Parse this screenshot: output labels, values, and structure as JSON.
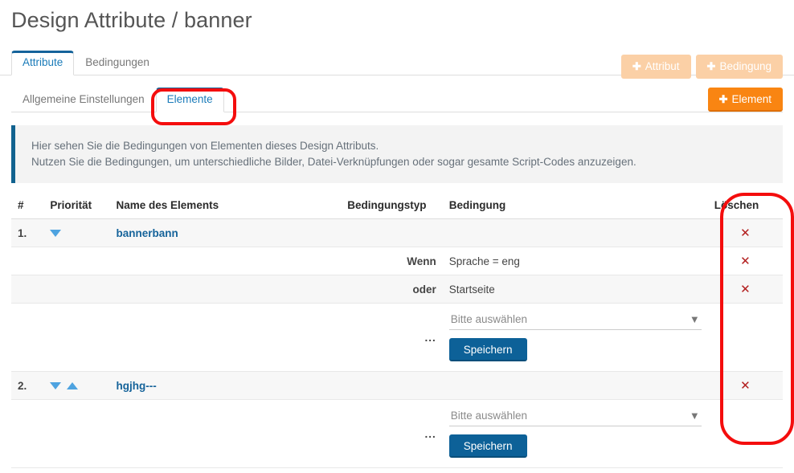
{
  "page": {
    "title": "Design Attribute / banner"
  },
  "main_tabs": [
    {
      "label": "Attribute",
      "active": true
    },
    {
      "label": "Bedingungen",
      "active": false
    }
  ],
  "top_actions": [
    {
      "label": "Attribut",
      "icon": "plus-icon",
      "state": "disabled"
    },
    {
      "label": "Bedingung",
      "icon": "plus-icon",
      "state": "disabled"
    }
  ],
  "sub_tabs": [
    {
      "label": "Allgemeine Einstellungen",
      "active": false
    },
    {
      "label": "Elemente",
      "active": true
    }
  ],
  "element_button": {
    "label": "Element",
    "icon": "plus-icon"
  },
  "info": {
    "line1": "Hier sehen Sie die Bedingungen von Elementen dieses Design Attributs.",
    "line2": "Nutzen Sie die Bedingungen, um unterschiedliche Bilder, Datei-Verknüpfungen oder sogar gesamte Script-Codes anzuzeigen."
  },
  "table": {
    "headers": {
      "num": "#",
      "priority": "Priorität",
      "name": "Name des Elements",
      "condition_type": "Bedingungstyp",
      "condition": "Bedingung",
      "delete": "Löschen"
    },
    "rows": [
      {
        "kind": "element",
        "index": "1.",
        "name": "bannerbann",
        "arrows": [
          "down"
        ],
        "condition_type": "",
        "condition": "",
        "delete": "✕"
      },
      {
        "kind": "condition",
        "index": "",
        "name": "",
        "arrows": [],
        "condition_type": "Wenn",
        "condition": "Sprache = eng",
        "delete": "✕"
      },
      {
        "kind": "condition",
        "index": "",
        "name": "",
        "arrows": [],
        "condition_type": "oder",
        "condition": "Startseite",
        "delete": "✕"
      },
      {
        "kind": "form",
        "index": "",
        "name": "",
        "arrows": [],
        "condition_type": "...",
        "select_value": "Bitte auswählen",
        "save_label": "Speichern",
        "delete": ""
      },
      {
        "kind": "element",
        "index": "2.",
        "name": "hgjhg---",
        "arrows": [
          "down",
          "up"
        ],
        "condition_type": "",
        "condition": "",
        "delete": "✕"
      },
      {
        "kind": "form",
        "index": "",
        "name": "",
        "arrows": [],
        "condition_type": "...",
        "select_value": "Bitte auswählen",
        "save_label": "Speichern",
        "delete": ""
      }
    ]
  },
  "annotations": [
    {
      "target": "Elemente tab",
      "color": "#f40d0d"
    },
    {
      "target": "Löschen column",
      "color": "#f40d0d"
    }
  ],
  "colors": {
    "accent_blue": "#15639a",
    "link_blue": "#1a7bb9",
    "orange": "#f98512",
    "orange_disabled": "#fbd0a6",
    "annotation_red": "#f40d0d",
    "delete_red": "#b32020",
    "arrow_blue": "#4ea3e0"
  }
}
